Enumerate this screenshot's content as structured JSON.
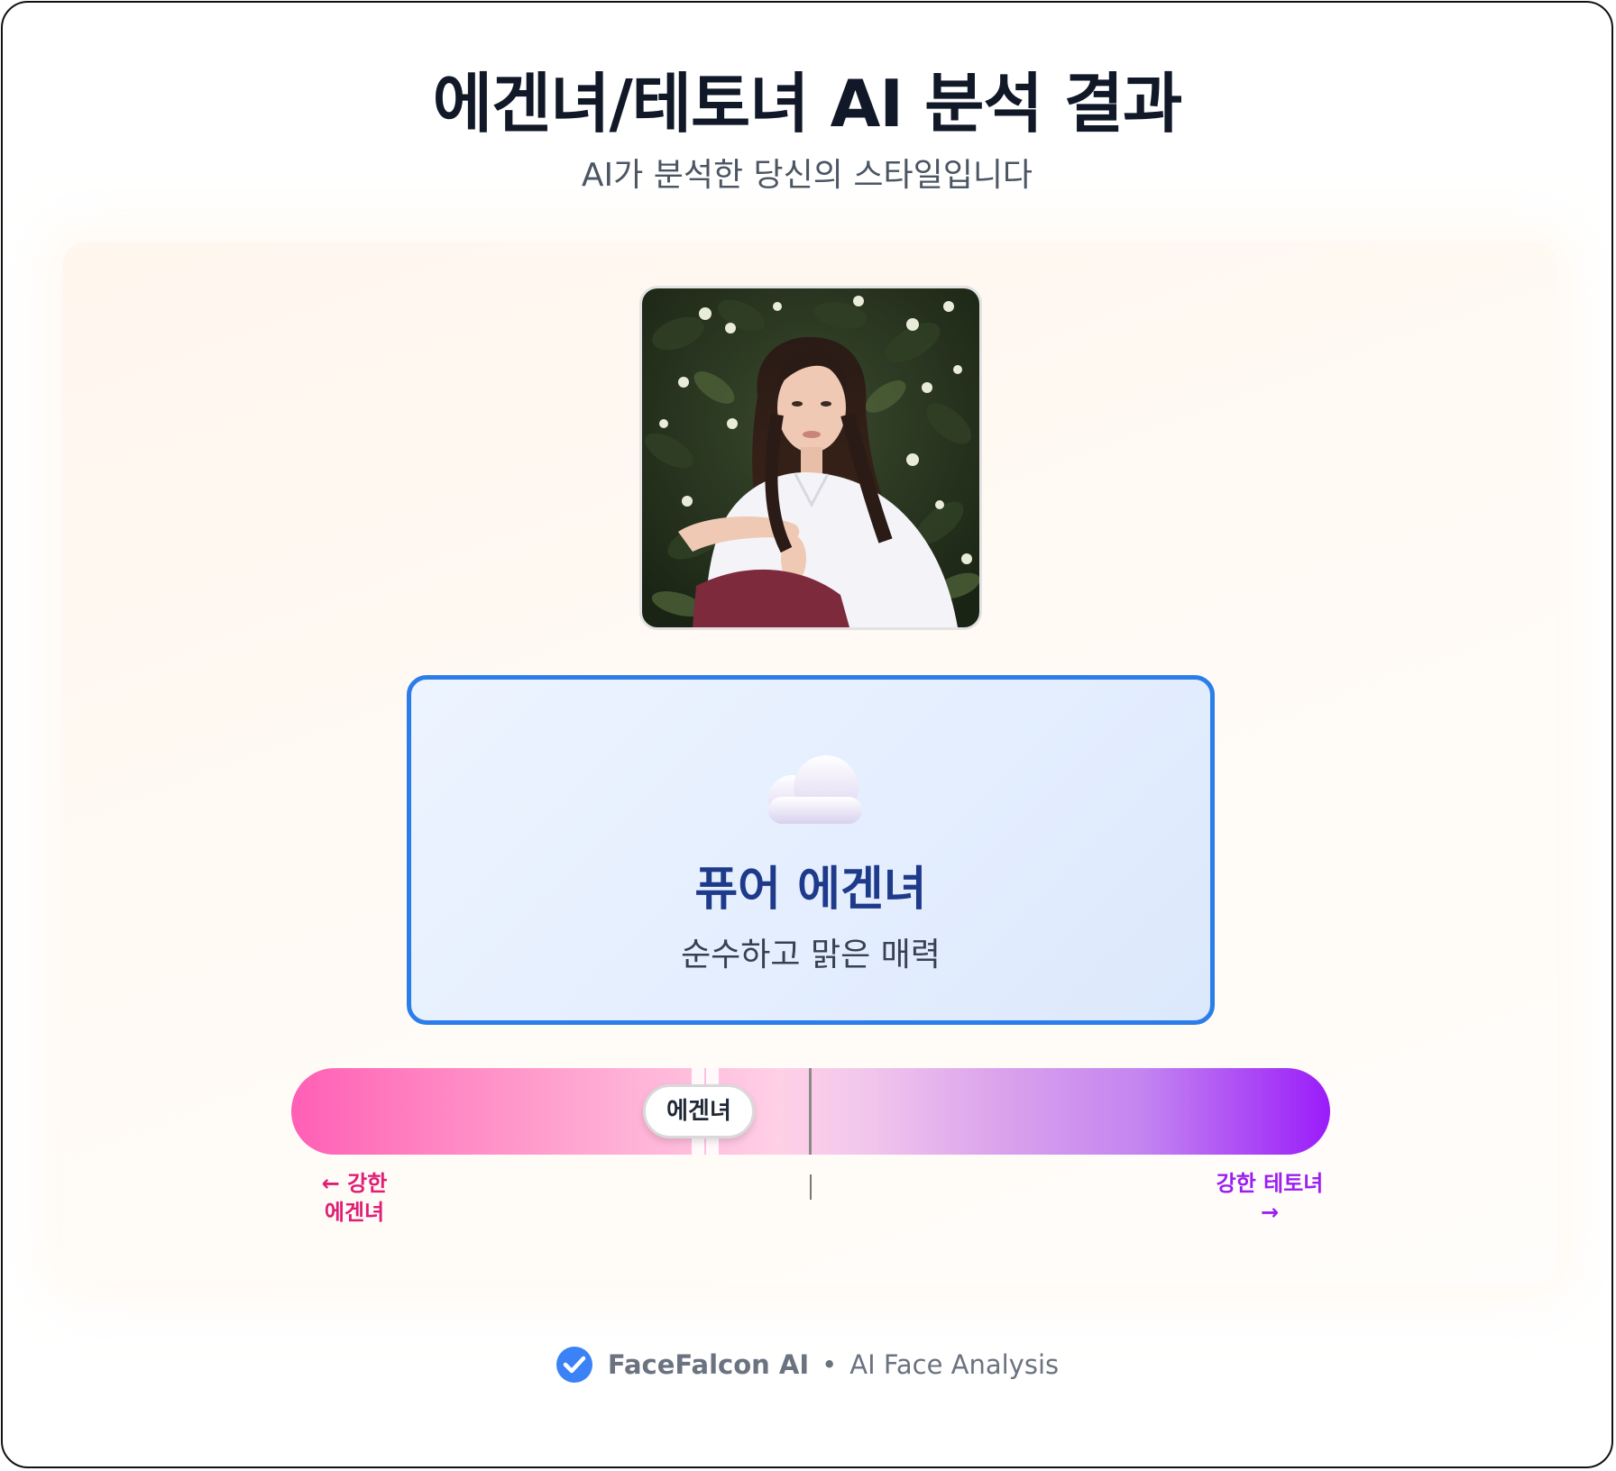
{
  "header": {
    "title": "에겐녀/테토녀 AI 분석 결과",
    "subtitle": "AI가 분석한 당신의 스타일입니다"
  },
  "photo": {
    "alt": "사진",
    "icon": "portrait-photo"
  },
  "result": {
    "icon": "cloud-icon",
    "title": "퓨어 에겐녀",
    "description": "순수하고 맑은 매력",
    "accent_color": "#2b7de9"
  },
  "scale": {
    "marker_label": "에겐녀",
    "left_label_line1": "← 강한",
    "left_label_line2": "에겐녀",
    "right_label_line1": "강한 테토녀",
    "right_label_line2": "→",
    "left_color": "#ff5fb5",
    "right_color": "#9a1cfa"
  },
  "footer": {
    "icon": "check-circle-icon",
    "brand": "FaceFalcon AI",
    "separator": "•",
    "tagline": "AI Face Analysis"
  }
}
